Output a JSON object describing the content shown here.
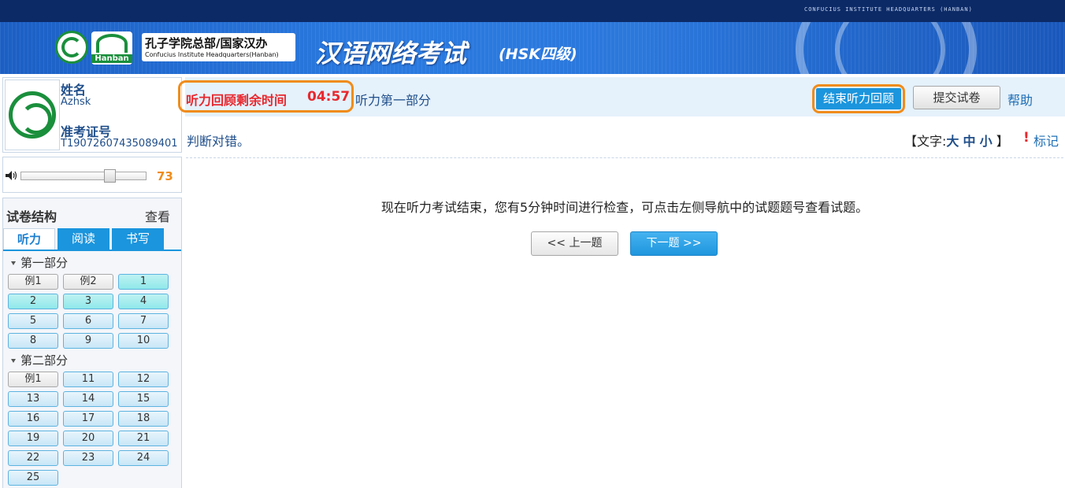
{
  "header": {
    "org_en_caps": "CONFUCIUS INSTITUTE HEADQUARTERS (HANBAN)",
    "hanban_logo_text": "Hanban",
    "ci_cn": "孔子学院总部/国家汉办",
    "ci_en": "Confucius Institute Headquarters(Hanban)",
    "exam_title": "汉语网络考试",
    "exam_level": "(HSK四级)"
  },
  "profile": {
    "name_label": "姓名",
    "name_value": "Azhsk",
    "id_label": "准考证号",
    "id_value": "T19072607435089401"
  },
  "volume": {
    "value": "73",
    "level_fraction": 0.73
  },
  "structure": {
    "title": "试卷结构",
    "view_link": "查看",
    "tabs": [
      "听力",
      "阅读",
      "书写"
    ],
    "sections": [
      {
        "title": "第一部分",
        "buttons": [
          {
            "label": "例1",
            "state": "example"
          },
          {
            "label": "例2",
            "state": "example"
          },
          {
            "label": "1",
            "state": "answered"
          },
          {
            "label": "2",
            "state": "answered"
          },
          {
            "label": "3",
            "state": "answered"
          },
          {
            "label": "4",
            "state": "answered"
          },
          {
            "label": "5",
            "state": "normal"
          },
          {
            "label": "6",
            "state": "normal"
          },
          {
            "label": "7",
            "state": "normal"
          },
          {
            "label": "8",
            "state": "normal"
          },
          {
            "label": "9",
            "state": "normal"
          },
          {
            "label": "10",
            "state": "normal"
          }
        ]
      },
      {
        "title": "第二部分",
        "buttons": [
          {
            "label": "例1",
            "state": "example"
          },
          {
            "label": "11",
            "state": "normal"
          },
          {
            "label": "12",
            "state": "normal"
          },
          {
            "label": "13",
            "state": "normal"
          },
          {
            "label": "14",
            "state": "normal"
          },
          {
            "label": "15",
            "state": "normal"
          },
          {
            "label": "16",
            "state": "normal"
          },
          {
            "label": "17",
            "state": "normal"
          },
          {
            "label": "18",
            "state": "normal"
          },
          {
            "label": "19",
            "state": "normal"
          },
          {
            "label": "20",
            "state": "normal"
          },
          {
            "label": "21",
            "state": "normal"
          },
          {
            "label": "22",
            "state": "normal"
          },
          {
            "label": "23",
            "state": "normal"
          },
          {
            "label": "24",
            "state": "normal"
          },
          {
            "label": "25",
            "state": "normal"
          }
        ]
      }
    ]
  },
  "toolbar": {
    "timer_label": "听力回顾剩余时间",
    "timer_value": "04:57",
    "part_title": "听力第一部分",
    "end_review_button": "结束听力回顾",
    "submit_button": "提交试卷",
    "help_link": "帮助"
  },
  "question": {
    "instruction": "判断对错。",
    "font_prefix": "【文字:",
    "font_large": "大",
    "font_medium": "中",
    "font_small": "小",
    "font_suffix": "】",
    "mark_link": "标记",
    "message": "现在听力考试结束，您有5分钟时间进行检查，可点击左侧导航中的试题题号查看试题。",
    "prev_button": "<< 上一题",
    "next_button": "下一题 >>"
  },
  "colors": {
    "accent_blue": "#1b95dd",
    "highlight_orange": "#f08c1a",
    "timer_red": "#e8282e",
    "text_navy": "#1f4e8a"
  }
}
